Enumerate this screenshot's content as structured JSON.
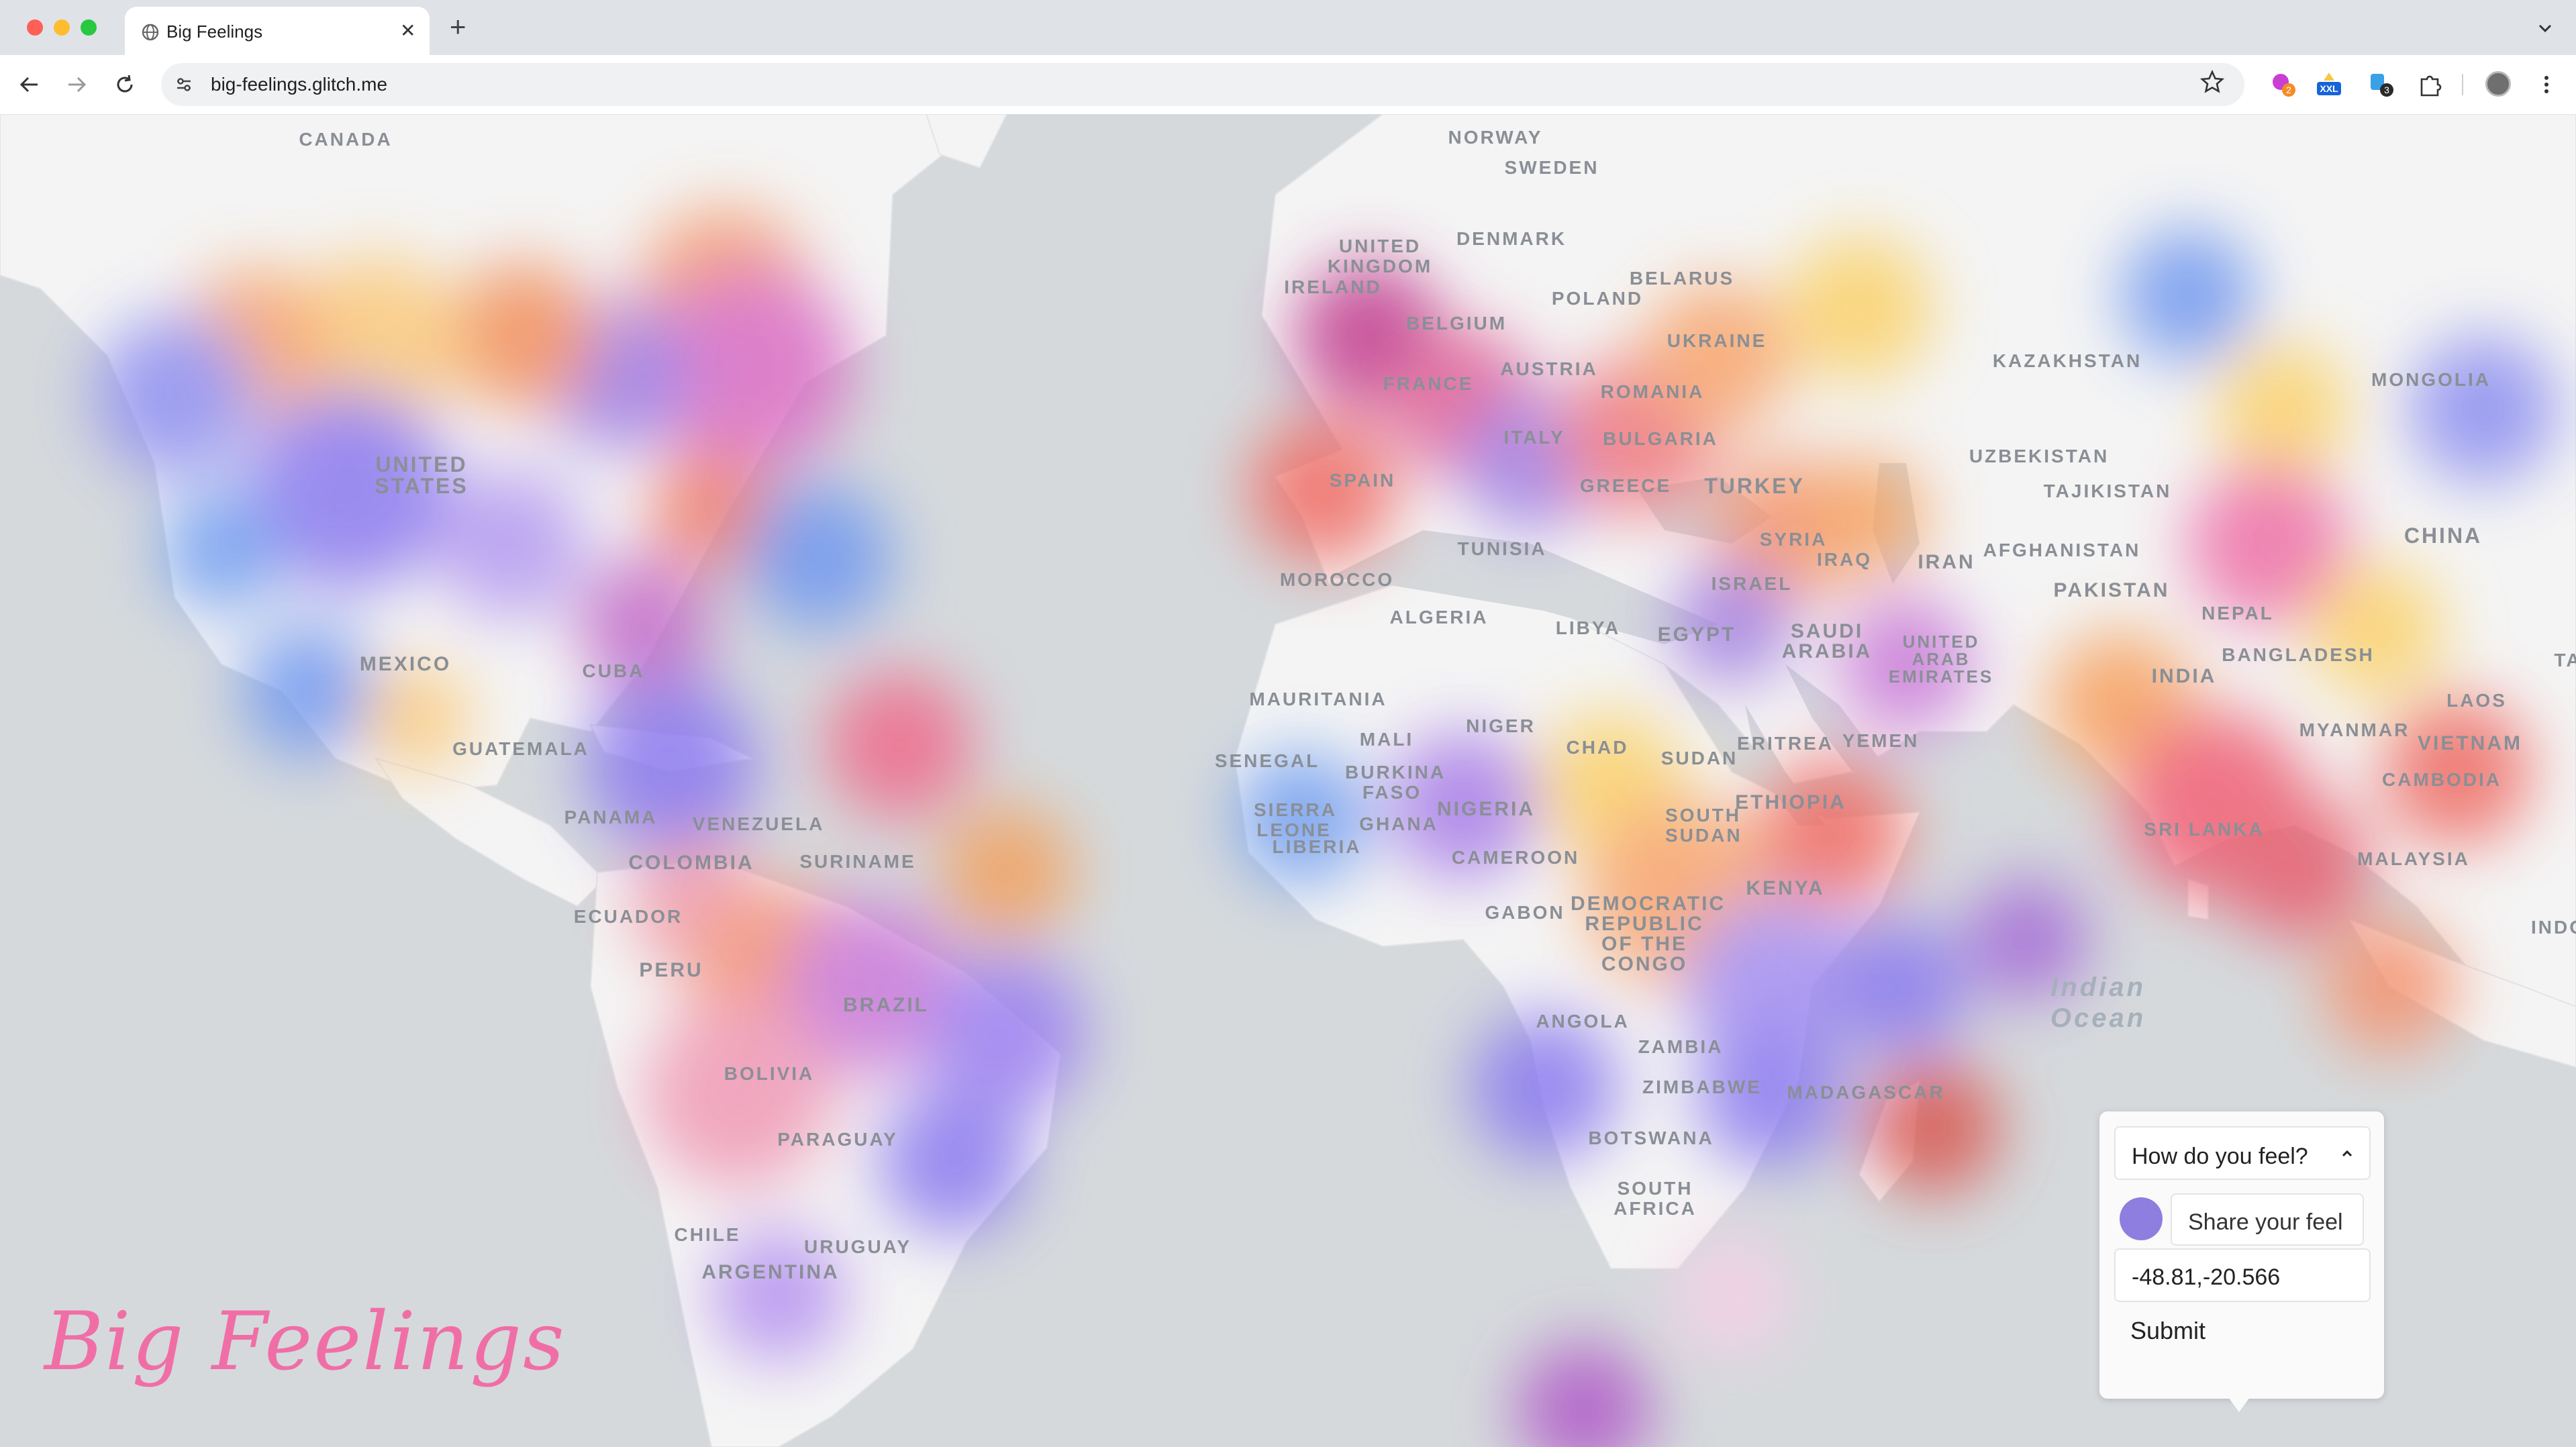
{
  "browser": {
    "tab_title": "Big Feelings",
    "url": "big-feelings.glitch.me",
    "extension_badges": [
      "2",
      "XXL",
      "3"
    ]
  },
  "map": {
    "labels": [
      "CANADA",
      "NORWAY",
      "SWEDEN",
      "DENMARK",
      "UNITED KINGDOM",
      "IRELAND",
      "BELARUS",
      "POLAND",
      "BELGIUM",
      "UKRAINE",
      "KAZAKHSTAN",
      "MONGOLIA",
      "FRANCE",
      "AUSTRIA",
      "ROMANIA",
      "UNITED STATES",
      "ITALY",
      "BULGARIA",
      "UZBEKISTAN",
      "SPAIN",
      "GREECE",
      "TURKEY",
      "TAJIKISTAN",
      "CHINA",
      "TUNISIA",
      "AFGHANISTAN",
      "SYRIA",
      "IRAQ",
      "IRAN",
      "MOROCCO",
      "ISRAEL",
      "PAKISTAN",
      "NEPAL",
      "ALGERIA",
      "LIBYA",
      "EGYPT",
      "SAUDI ARABIA",
      "UNITED ARAB EMIRATES",
      "BANGLADESH",
      "INDIA",
      "MEXICO",
      "CUBA",
      "LAOS",
      "MAURITANIA",
      "MYANMAR",
      "VIETNAM",
      "NIGER",
      "MALI",
      "CHAD",
      "SUDAN",
      "ERITREA",
      "YEMEN",
      "GUATEMALA",
      "SENEGAL",
      "BURKINA FASO",
      "CAMBODIA",
      "PANAMA",
      "VENEZUELA",
      "ETHIOPIA",
      "SIERRA LEONE",
      "LIBERIA",
      "GHANA",
      "NIGERIA",
      "SOUTH SUDAN",
      "SRI LANKA",
      "COLOMBIA",
      "SURINAME",
      "CAMEROON",
      "MALAYSIA",
      "KENYA",
      "ECUADOR",
      "GABON",
      "DEMOCRATIC REPUBLIC OF THE CONGO",
      "INDO",
      "PERU",
      "BRAZIL",
      "ANGOLA",
      "ZAMBIA",
      "BOLIVIA",
      "ZIMBABWE",
      "MADAGASCAR",
      "PARAGUAY",
      "BOTSWANA",
      "SOUTH AFRICA",
      "CHILE",
      "URUGUAY",
      "ARGENTINA",
      "TA"
    ],
    "ocean_label": "Indian Ocean"
  },
  "brand": "Big Feelings",
  "popup": {
    "question": "How do you feel?",
    "feel_placeholder": "Share your feel",
    "coordinates": "-48.81,-20.566",
    "submit_label": "Submit",
    "selected_color": "#8d7ee0"
  }
}
